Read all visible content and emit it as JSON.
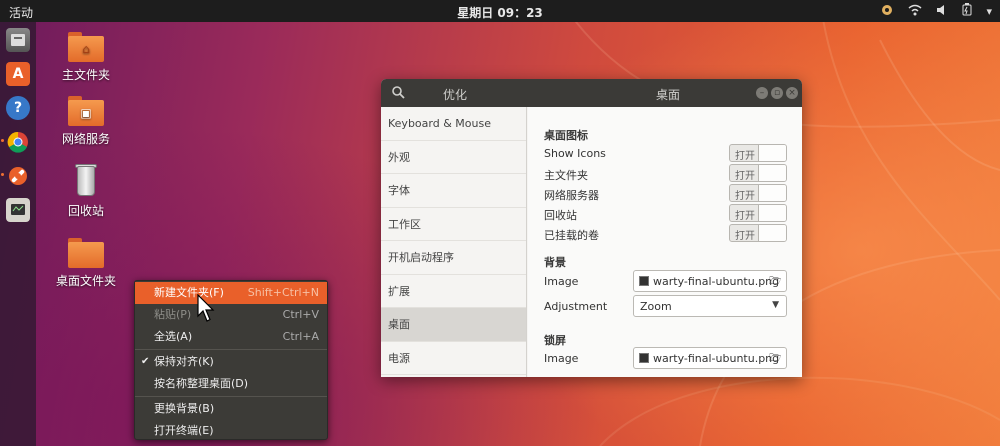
{
  "topbar": {
    "activities": "活动",
    "clock": "星期日 09：23"
  },
  "dock": {
    "items": [
      {
        "icon": "files-icon"
      },
      {
        "icon": "software-center-icon",
        "glyph": "A"
      },
      {
        "icon": "help-icon",
        "glyph": "?"
      },
      {
        "icon": "chrome-icon"
      },
      {
        "icon": "tweaks-icon"
      },
      {
        "icon": "system-monitor-icon"
      }
    ]
  },
  "desktop": {
    "icons": [
      {
        "label": "主文件夹",
        "icon": "home-folder-icon"
      },
      {
        "label": "网络服务",
        "icon": "network-folder-icon"
      },
      {
        "label": "回收站",
        "icon": "trash-icon"
      },
      {
        "label": "桌面文件夹",
        "icon": "desktop-folder-icon"
      }
    ]
  },
  "context_menu": {
    "items": [
      {
        "label": "新建文件夹(F)",
        "accel": "Shift+Ctrl+N",
        "state": "highlighted"
      },
      {
        "label": "粘贴(P)",
        "accel": "Ctrl+V",
        "state": "disabled"
      },
      {
        "label": "全选(A)",
        "accel": "Ctrl+A",
        "state": "normal"
      },
      {
        "label": "保持对齐(K)",
        "accel": "",
        "state": "checked"
      },
      {
        "label": "按名称整理桌面(D)",
        "accel": "",
        "state": "normal"
      },
      {
        "label": "更换背景(B)",
        "accel": "",
        "state": "normal"
      },
      {
        "label": "打开终端(E)",
        "accel": "",
        "state": "normal"
      }
    ]
  },
  "window": {
    "app_name": "优化",
    "title": "桌面",
    "sidebar": [
      {
        "label": "Keyboard & Mouse"
      },
      {
        "label": "外观"
      },
      {
        "label": "字体"
      },
      {
        "label": "工作区"
      },
      {
        "label": "开机启动程序"
      },
      {
        "label": "扩展"
      },
      {
        "label": "桌面",
        "selected": true
      },
      {
        "label": "电源"
      }
    ],
    "sections": {
      "icons_title": "桌面图标",
      "toggles": [
        {
          "label": "Show Icons",
          "state": "打开"
        },
        {
          "label": "主文件夹",
          "state": "打开"
        },
        {
          "label": "网络服务器",
          "state": "打开"
        },
        {
          "label": "回收站",
          "state": "打开"
        },
        {
          "label": "已挂载的卷",
          "state": "打开"
        }
      ],
      "background_title": "背景",
      "background_image_label": "Image",
      "background_image_value": "warty-final-ubuntu.png",
      "adjustment_label": "Adjustment",
      "adjustment_value": "Zoom",
      "lockscreen_title": "锁屏",
      "lock_image_label": "Image",
      "lock_image_value": "warty-final-ubuntu.png"
    }
  },
  "colors": {
    "accent": "#e9602a",
    "topbar": "#1d1d1d",
    "menu_bg": "#3c3b37"
  }
}
